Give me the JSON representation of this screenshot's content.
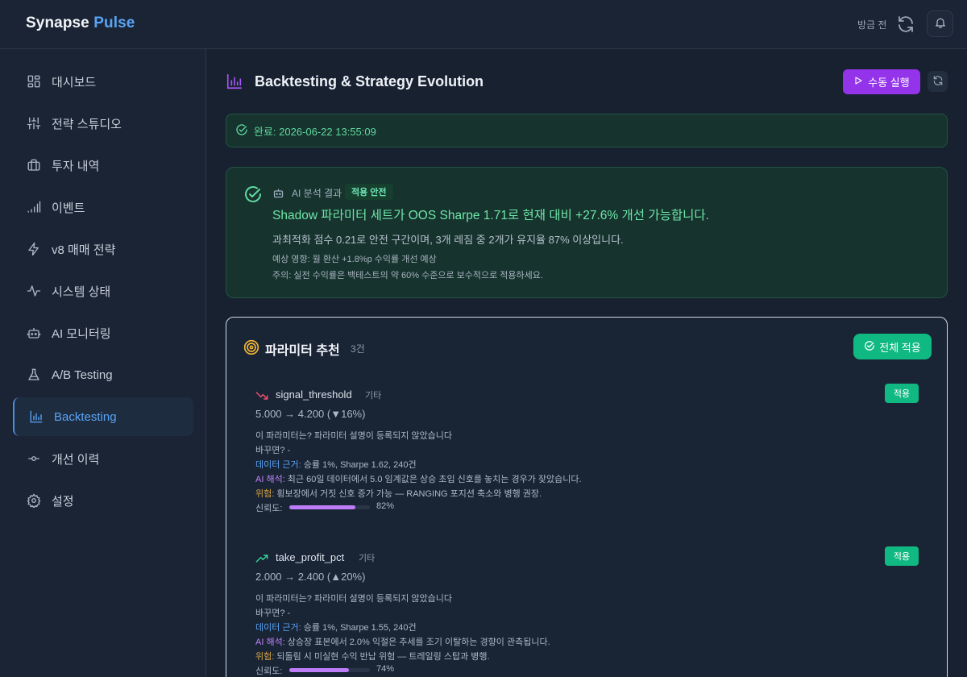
{
  "header": {
    "brand_primary": "Synapse",
    "brand_accent": "Pulse",
    "last_updated": "방금 전",
    "refresh_icon": "refresh-icon",
    "bell_icon": "bell-icon"
  },
  "sidebar": {
    "items": [
      {
        "label": "대시보드",
        "icon": "grid-icon",
        "active": false
      },
      {
        "label": "전략 스튜디오",
        "icon": "sliders-icon",
        "active": false
      },
      {
        "label": "투자 내역",
        "icon": "briefcase-icon",
        "active": false
      },
      {
        "label": "이벤트",
        "icon": "signal-icon",
        "active": false
      },
      {
        "label": "v8 매매 전략",
        "icon": "zap-icon",
        "active": false
      },
      {
        "label": "시스템 상태",
        "icon": "activity-icon",
        "active": false
      },
      {
        "label": "AI 모니터링",
        "icon": "robot-icon",
        "active": false
      },
      {
        "label": "A/B Testing",
        "icon": "flask-icon",
        "active": false
      },
      {
        "label": "Backtesting",
        "icon": "bar-chart-icon",
        "active": true
      },
      {
        "label": "개선 이력",
        "icon": "commit-icon",
        "active": false
      },
      {
        "label": "설정",
        "icon": "gear-icon",
        "active": false
      }
    ]
  },
  "main": {
    "title": "Backtesting & Strategy Evolution",
    "run_button": "수동 실행",
    "status": "완료: 2026-06-22 13:55:09",
    "ai_analysis": {
      "label": "AI 분석 결과",
      "badge": "적용 안전",
      "headline": "Shadow 파라미터 세트가 OOS Sharpe 1.71로 현재 대비 +27.6% 개선 가능합니다.",
      "detail": "과최적화 점수 0.21로 안전 구간이며, 3개 레짐 중 2개가 유지율 87% 이상입니다.",
      "impact": "예상 영향: 월 환산 +1.8%p 수익률 개선 예상",
      "caution": "주의: 실전 수익률은 백테스트의 약 60% 수준으로 보수적으로 적용하세요."
    },
    "params": {
      "title": "파라미터 추천",
      "count": "3건",
      "apply_all": "전체 적용",
      "items": [
        {
          "name": "signal_threshold",
          "category": "기타",
          "trend": "down",
          "change": "5.000 → 4.200 (▼16%)",
          "description": "이 파라미터는? 파라미터 설명이 등록되지 않았습니다",
          "if_changed": "바꾸면? -",
          "evidence_key": "데이터 근거:",
          "evidence": " 승률 1%, Sharpe 1.62, 240건",
          "ai_key": "AI 해석:",
          "ai": " 최근 60일 데이터에서 5.0 임계값은 상승 초입 신호를 놓치는 경우가 잦았습니다.",
          "risk_key": "위험:",
          "risk": " 횡보장에서 거짓 신호 증가 가능 — RANGING 포지션 축소와 병행 권장.",
          "confidence_label": "신뢰도:",
          "confidence": 0.82,
          "confidence_text": "82%",
          "apply": "적용"
        },
        {
          "name": "take_profit_pct",
          "category": "기타",
          "trend": "up",
          "change": "2.000 → 2.400 (▲20%)",
          "description": "이 파라미터는? 파라미터 설명이 등록되지 않았습니다",
          "if_changed": "바꾸면? -",
          "evidence_key": "데이터 근거:",
          "evidence": " 승률 1%, Sharpe 1.55, 240건",
          "ai_key": "AI 해석:",
          "ai": " 상승장 표본에서 2.0% 익절은 추세를 조기 이탈하는 경향이 관측됩니다.",
          "risk_key": "위험:",
          "risk": " 되돌림 시 미실현 수익 반납 위험 — 트레일링 스탑과 병행.",
          "confidence_label": "신뢰도:",
          "confidence": 0.74,
          "confidence_text": "74%",
          "apply": "적용"
        }
      ]
    }
  },
  "colors": {
    "background": "#172130",
    "accent_blue": "#5aa4f5",
    "success_green": "#10b981",
    "purple": "#9333ea",
    "confidence_fill": "#bd7df9"
  }
}
